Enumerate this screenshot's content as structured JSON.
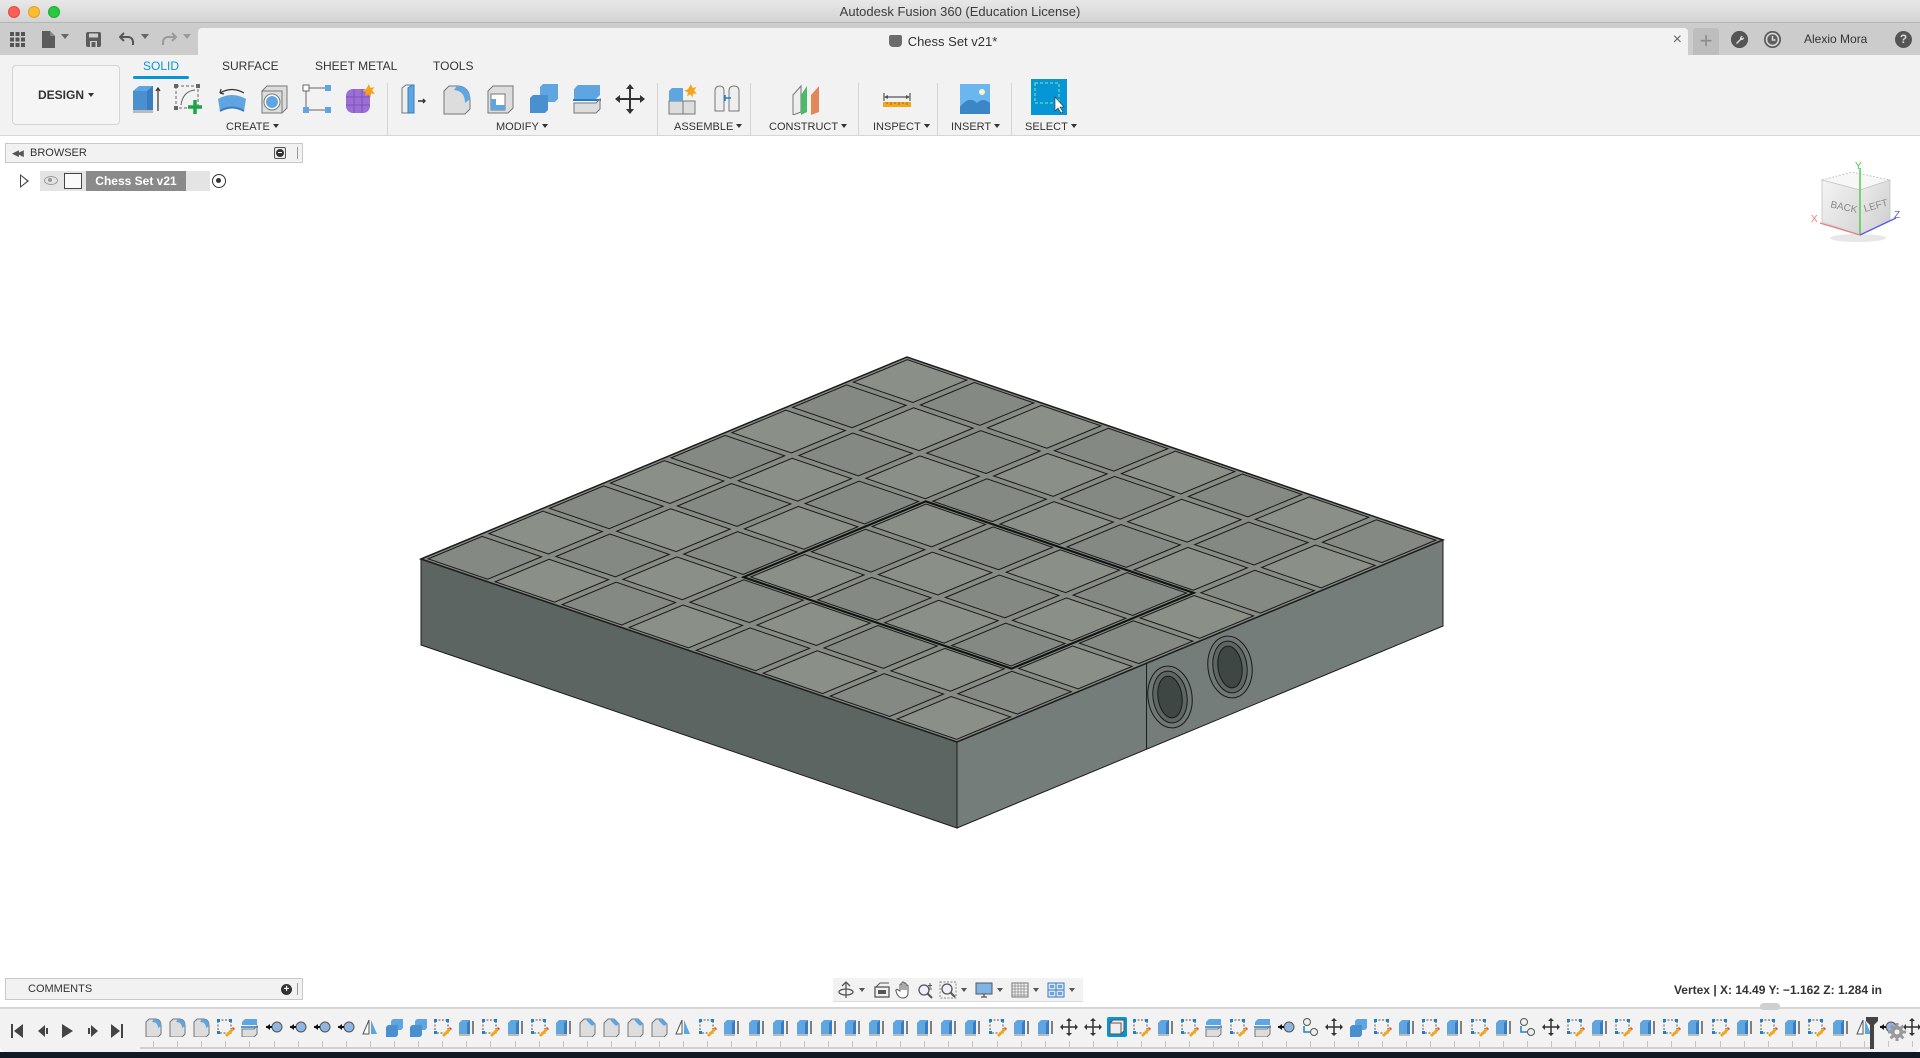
{
  "window": {
    "title": "Autodesk Fusion 360 (Education License)"
  },
  "quick_access": {
    "icons": [
      "data-panel-grid-icon",
      "file-icon",
      "save-icon",
      "undo-icon",
      "redo-icon"
    ]
  },
  "document_tab": {
    "title": "Chess Set v21*",
    "close_label": "×"
  },
  "tab_bar_right": {
    "new_tab_label": "+",
    "user_name": "Alexio Mora",
    "help_label": "?"
  },
  "ribbon": {
    "workspace_label": "DESIGN",
    "tabs": [
      {
        "label": "SOLID",
        "active": true
      },
      {
        "label": "SURFACE",
        "active": false
      },
      {
        "label": "SHEET METAL",
        "active": false
      },
      {
        "label": "TOOLS",
        "active": false
      }
    ],
    "groups": [
      {
        "label": "CREATE",
        "tools": [
          "extrude",
          "create-sketch",
          "revolve",
          "hole",
          "rectangular-pattern",
          "create-form"
        ]
      },
      {
        "label": "MODIFY",
        "tools": [
          "press-pull",
          "fillet",
          "shell",
          "combine",
          "split-body",
          "move-copy"
        ]
      },
      {
        "label": "ASSEMBLE",
        "tools": [
          "new-component",
          "joint"
        ]
      },
      {
        "label": "CONSTRUCT",
        "tools": [
          "offset-plane"
        ]
      },
      {
        "label": "INSPECT",
        "tools": [
          "measure"
        ]
      },
      {
        "label": "INSERT",
        "tools": [
          "insert-image"
        ]
      },
      {
        "label": "SELECT",
        "tools": [
          "window-select"
        ]
      }
    ]
  },
  "browser": {
    "title": "BROWSER",
    "root_item": "Chess Set v21"
  },
  "viewcube": {
    "faces": [
      "BACK",
      "LEFT"
    ],
    "axes": [
      "X",
      "Y",
      "Z"
    ],
    "colors": {
      "x": "#e87c7c",
      "y": "#48c848",
      "z": "#5a5af0"
    }
  },
  "model": {
    "name": "Chess board",
    "grid": 8,
    "colors": {
      "top": "#868b84",
      "left_side": "#5c6561",
      "right_side": "#747d79",
      "edge": "#1c1c1c"
    }
  },
  "comments": {
    "title": "COMMENTS"
  },
  "status": {
    "text": "Vertex | X: 14.49 Y: −1.162 Z: 1.284 in"
  },
  "timeline": {
    "controls": [
      "go-to-start",
      "step-back",
      "play",
      "step-forward",
      "go-to-end"
    ],
    "features": [
      "fillet",
      "fillet",
      "fillet",
      "sketch",
      "split",
      "joint",
      "joint",
      "joint",
      "joint",
      "mirror",
      "combine",
      "combine",
      "sketch",
      "extrude",
      "sketch",
      "extrude",
      "sketch",
      "extrude",
      "chamfer",
      "chamfer",
      "chamfer",
      "chamfer",
      "mirror",
      "sketch",
      "extrude",
      "extrude",
      "extrude",
      "extrude",
      "extrude",
      "extrude",
      "extrude",
      "extrude",
      "extrude",
      "extrude",
      "extrude",
      "sketch",
      "extrude",
      "extrude",
      "move",
      "move",
      "box",
      "sketch",
      "extrude",
      "sketch",
      "split",
      "sketch",
      "split",
      "joint",
      "rigid-group",
      "move",
      "combine",
      "sketch",
      "extrude",
      "sketch",
      "extrude",
      "sketch",
      "extrude",
      "rigid-group",
      "move",
      "sketch",
      "extrude",
      "sketch",
      "extrude",
      "sketch",
      "extrude",
      "sketch",
      "extrude",
      "sketch",
      "extrude",
      "sketch",
      "extrude",
      "mirror",
      "joint",
      "move",
      "move"
    ],
    "selected_index": 40
  }
}
